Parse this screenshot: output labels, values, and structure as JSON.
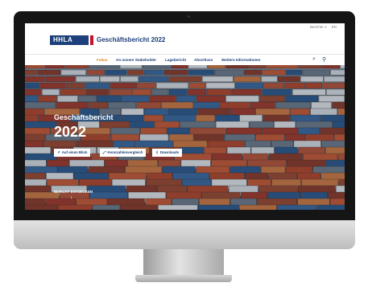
{
  "topbar": {
    "language_menu": "Berichte ∨",
    "language": "EN"
  },
  "header": {
    "logo_text": "HHLA",
    "title": "Geschäftsbericht 2022"
  },
  "nav": {
    "items": [
      "Fokus",
      "An unsere Stakeholder",
      "Lagebericht",
      "Abschluss",
      "Weitere Informationen"
    ],
    "search_icon": "search-icon",
    "bookmark_icon": "bookmark-icon"
  },
  "hero": {
    "title": "Geschäftsbericht",
    "year": "2022",
    "buttons": [
      {
        "label": "Auf einen Blick",
        "icon": "trend-icon"
      },
      {
        "label": "Kennzahlenvergleich",
        "icon": "chart-icon"
      },
      {
        "label": "Downloads",
        "icon": "download-icon"
      }
    ],
    "discover": "BERICHT ENTDECKEN"
  },
  "colors": {
    "brand_blue": "#1d3f7a",
    "accent_orange": "#e2841c",
    "logo_red": "#c8102e"
  }
}
